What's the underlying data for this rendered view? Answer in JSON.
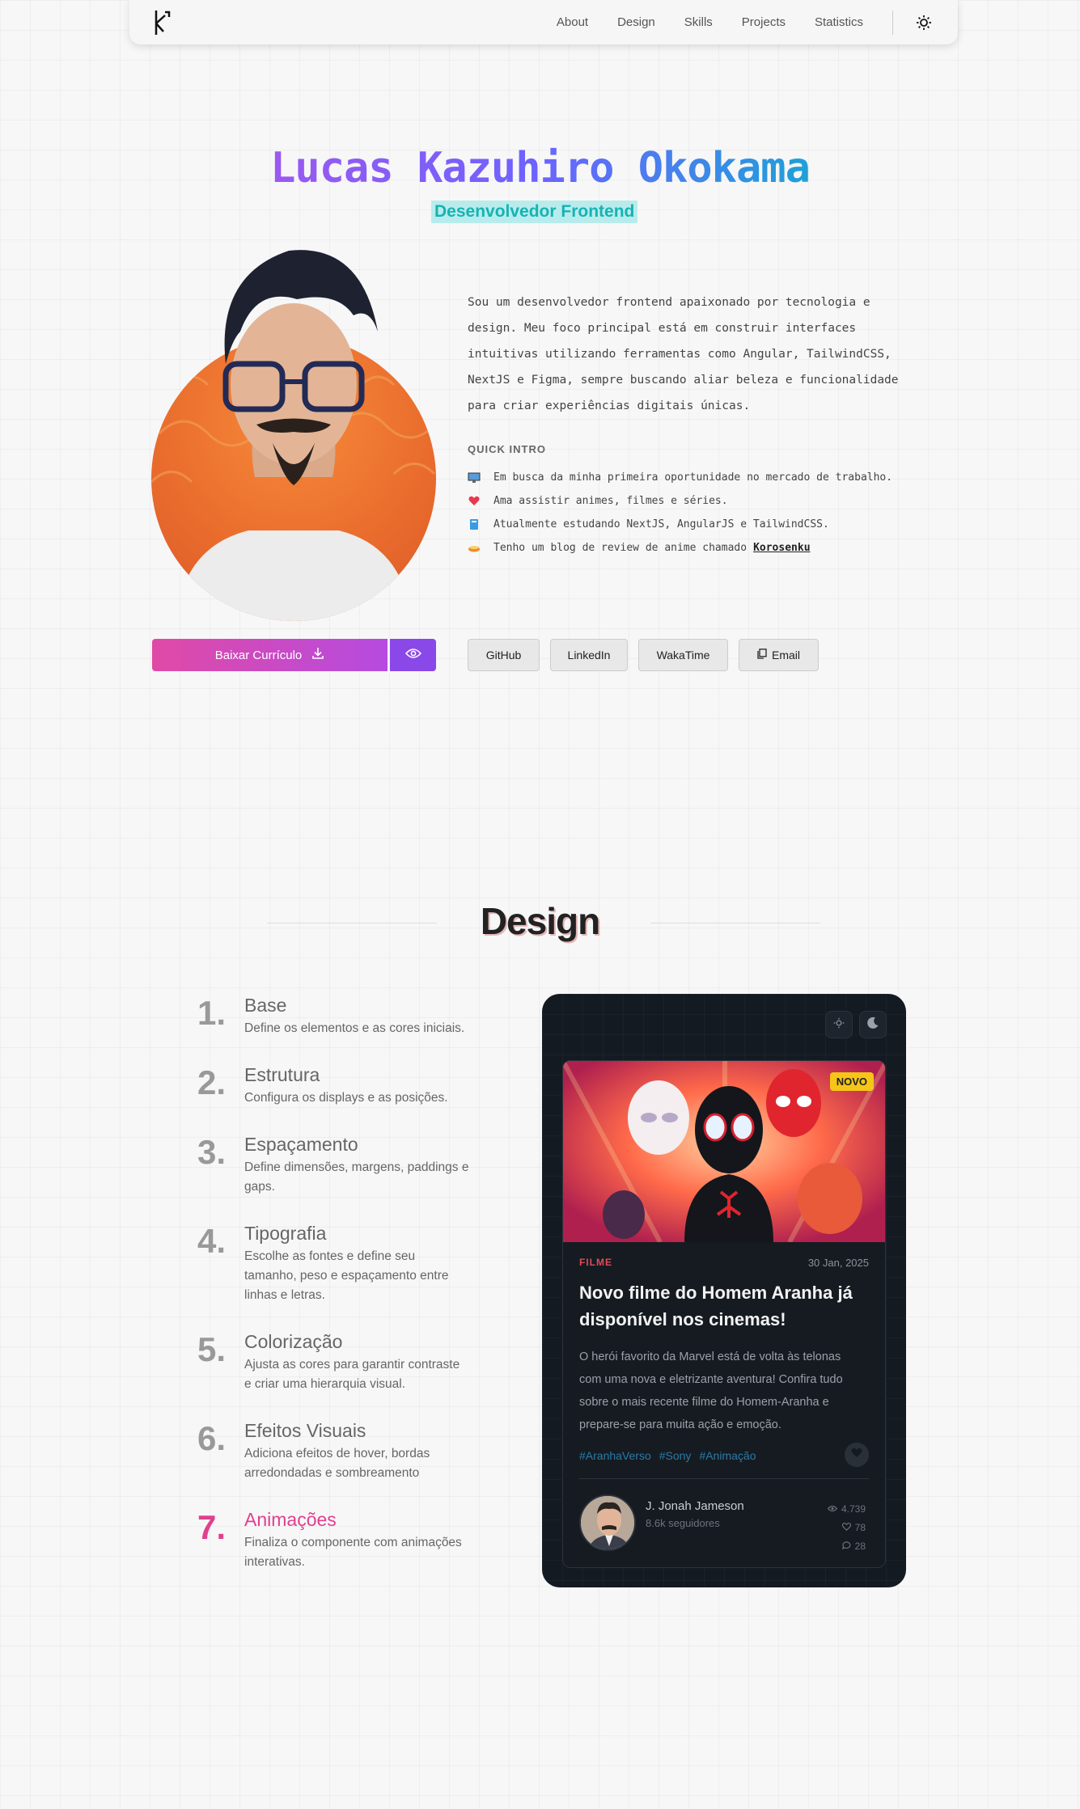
{
  "nav": {
    "links": [
      "About",
      "Design",
      "Skills",
      "Projects",
      "Statistics"
    ],
    "theme_icon": "sun-icon",
    "logo_icon": "k-logo-icon"
  },
  "hero": {
    "name": "Lucas Kazuhiro Okokama",
    "role": "Desenvolvedor Frontend",
    "bio": "Sou um desenvolvedor frontend apaixonado por tecnologia e design. Meu foco principal está em construir interfaces intuitivas utilizando ferramentas como Angular, TailwindCSS, NextJS e Figma, sempre buscando aliar beleza e funcionalidade para criar experiências digitais únicas.",
    "bio_lines": [
      "Sou um desenvolvedor frontend apaixonado por tecnologia e",
      "design. Meu foco principal está em construir interfaces",
      "intuitivas utilizando ferramentas como Angular, TailwindCSS,",
      "NextJS e Figma, sempre buscando aliar beleza e funcionalidade",
      "para criar experiências digitais únicas."
    ],
    "quick_intro_title": "QUICK INTRO",
    "quick_intro": [
      {
        "icon": "computer-icon",
        "text": "Em busca da minha primeira oportunidade no mercado de trabalho."
      },
      {
        "icon": "heart-icon",
        "text": "Ama assistir animes, filmes e séries."
      },
      {
        "icon": "book-icon",
        "text": "Atualmente estudando NextJS, AngularJS e TailwindCSS."
      },
      {
        "icon": "food-icon",
        "text": "Tenho um blog de review de anime chamado",
        "link": "Korosenku"
      }
    ],
    "cv_button": "Baixar Currículo",
    "social": [
      "GitHub",
      "LinkedIn",
      "WakaTime",
      "Email"
    ]
  },
  "design": {
    "title": "Design",
    "steps": [
      {
        "num": "1.",
        "title": "Base",
        "desc": [
          "Define os elementos e as cores iniciais."
        ]
      },
      {
        "num": "2.",
        "title": "Estrutura",
        "desc": [
          "Configura os displays e as posições."
        ]
      },
      {
        "num": "3.",
        "title": "Espaçamento",
        "desc": [
          "Define dimensões, margens, paddings e",
          "gaps."
        ]
      },
      {
        "num": "4.",
        "title": "Tipografia",
        "desc": [
          "Escolhe as fontes e define seu",
          "tamanho, peso e espaçamento entre",
          "linhas e letras."
        ]
      },
      {
        "num": "5.",
        "title": "Colorização",
        "desc": [
          "Ajusta as cores para garantir contraste",
          "e criar uma hierarquia visual."
        ]
      },
      {
        "num": "6.",
        "title": "Efeitos Visuais",
        "desc": [
          "Adiciona efeitos de hover, bordas",
          "arredondadas e sombreamento"
        ]
      },
      {
        "num": "7.",
        "title": "Animações",
        "desc": [
          "Finaliza o componente com animações",
          "interativas."
        ]
      }
    ],
    "active_step": 7,
    "accent_color": "#e0408f"
  },
  "card": {
    "badge": "NOVO",
    "category": "FILME",
    "date": "30 Jan, 2025",
    "title_lines": [
      "Novo filme do Homem Aranha já",
      "disponível nos cinemas!"
    ],
    "desc_lines": [
      "O herói favorito da Marvel está de volta às telonas",
      "com uma nova e eletrizante aventura! Confira tudo",
      "sobre o mais recente filme do Homem-Aranha e",
      "prepare-se para muita ação e emoção."
    ],
    "tags": [
      "#AranhaVerso",
      "#Sony",
      "#Animação"
    ],
    "author": "J. Jonah Jameson",
    "followers": "8.6k seguidores",
    "views": "4.739",
    "likes": "78",
    "comments": "28"
  }
}
